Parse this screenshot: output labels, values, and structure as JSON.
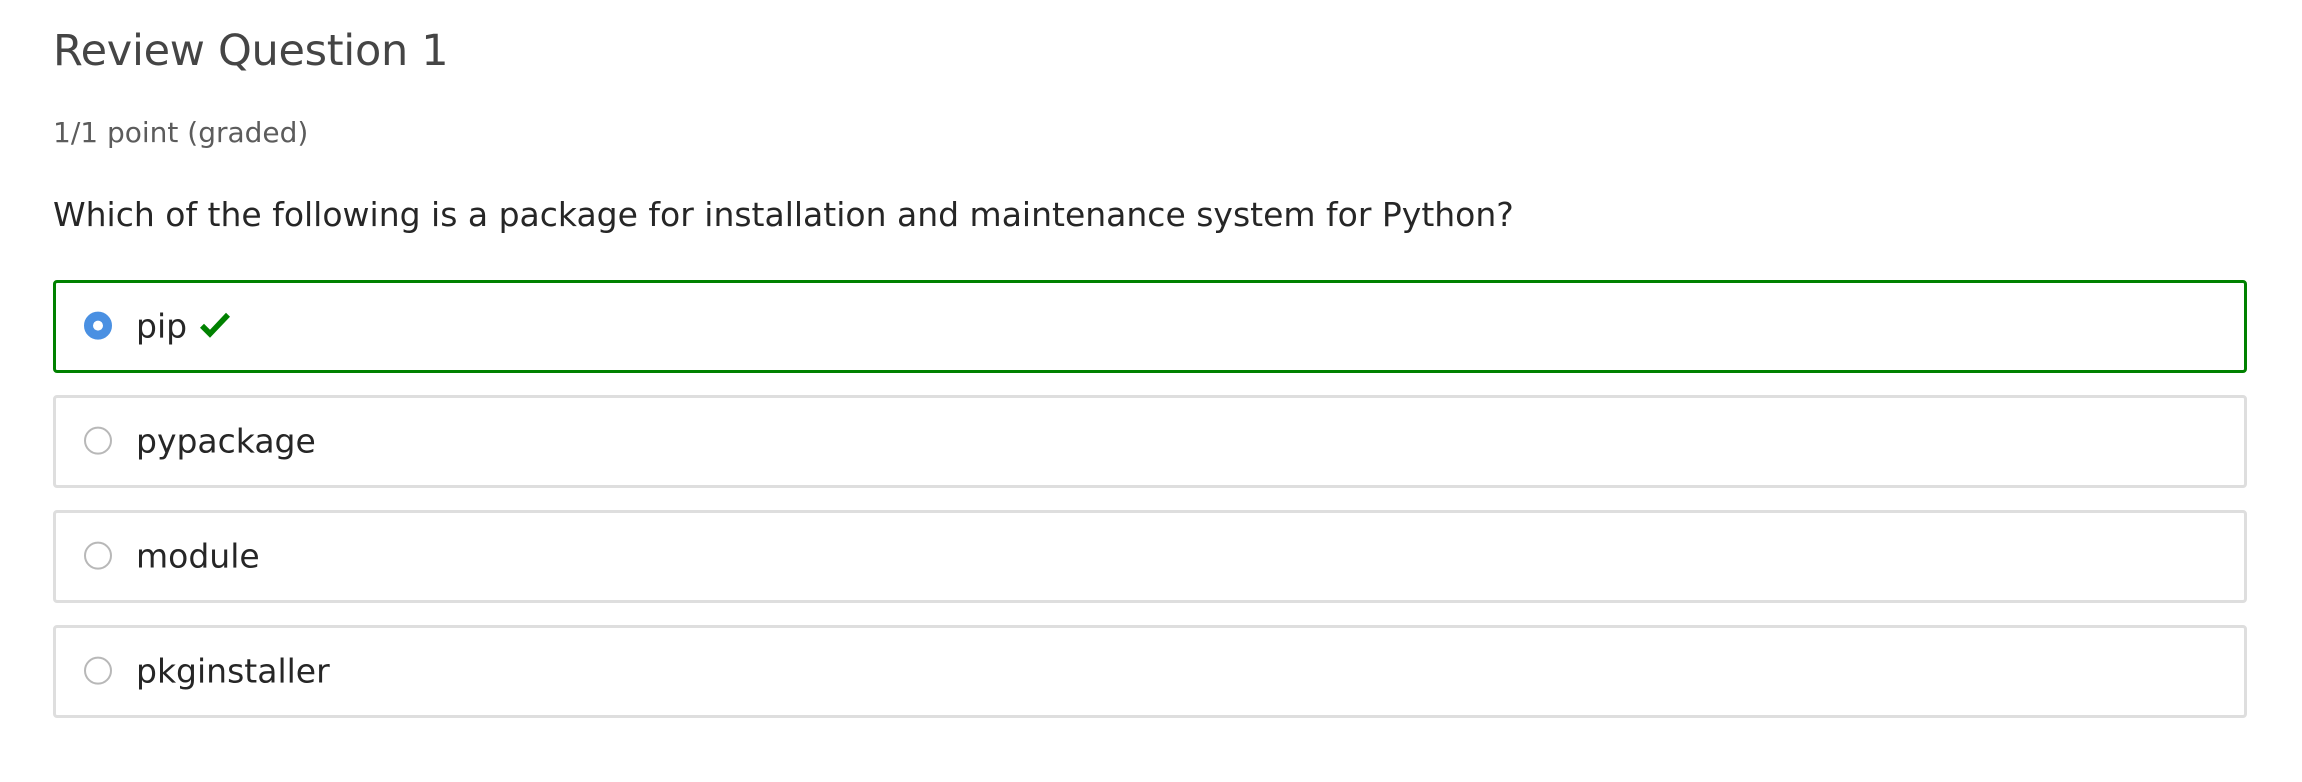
{
  "question": {
    "title": "Review Question 1",
    "points": "1/1 point (graded)",
    "prompt": "Which of the following is a package for installation and maintenance system for Python?"
  },
  "options": [
    {
      "label": "pip",
      "selected": true,
      "correct": true
    },
    {
      "label": "pypackage",
      "selected": false,
      "correct": false
    },
    {
      "label": "module",
      "selected": false,
      "correct": false
    },
    {
      "label": "pkginstaller",
      "selected": false,
      "correct": false
    }
  ],
  "icons": {
    "correct": "check-icon"
  },
  "colors": {
    "correct_border": "#008100",
    "correct_icon": "#008100",
    "selected_radio": "#4a90e2",
    "option_border": "#dedede"
  }
}
